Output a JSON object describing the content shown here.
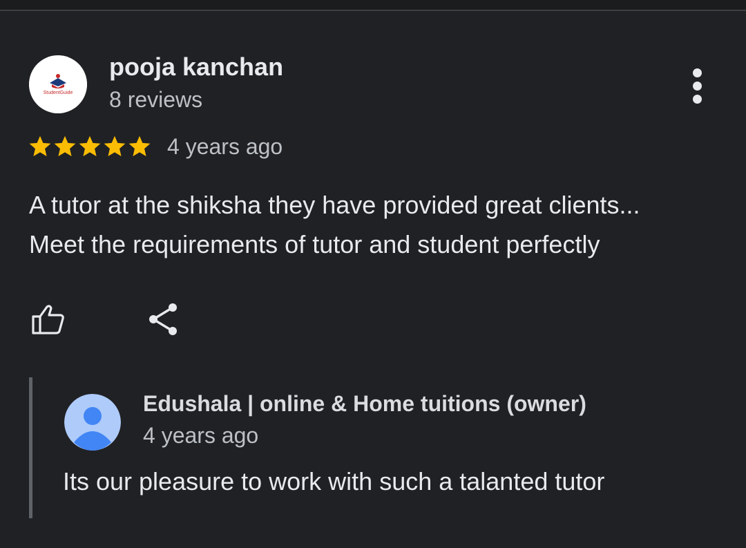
{
  "review": {
    "reviewer_name": "pooja kanchan",
    "reviewer_review_count": "8 reviews",
    "avatar_logo_text": "StudentGuide",
    "rating": 5,
    "rating_max": 5,
    "time_ago": "4 years ago",
    "text_lines": [
      "A tutor at the shiksha they have provided great clients...",
      "Meet the requirements of tutor and student perfectly"
    ]
  },
  "actions": {
    "like_icon": "thumbs-up-icon",
    "share_icon": "share-icon",
    "more_icon": "more-vert-icon"
  },
  "owner_reply": {
    "name": "Edushala | online & Home tuitions (owner)",
    "time_ago": "4 years ago",
    "text": "Its our pleasure to work with such a talanted tutor"
  },
  "colors": {
    "background": "#202124",
    "star": "#fbbc04",
    "text_primary": "#e8eaed",
    "text_secondary": "#bdc1c6",
    "reply_border": "#5f6368",
    "owner_avatar_bg": "#aecbfa",
    "owner_avatar_fg": "#4285f4"
  }
}
